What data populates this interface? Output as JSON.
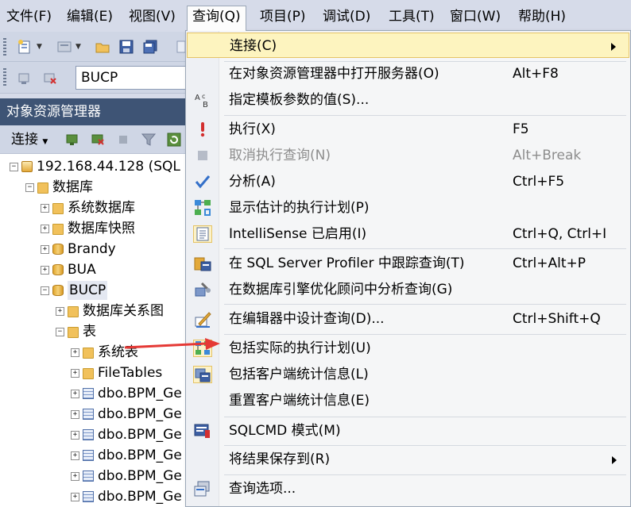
{
  "menubar": {
    "items": [
      "文件(F)",
      "编辑(E)",
      "视图(V)",
      "查询(Q)",
      "项目(P)",
      "调试(D)",
      "工具(T)",
      "窗口(W)",
      "帮助(H)"
    ]
  },
  "toolbar": {
    "database_combo": "BUCP"
  },
  "object_explorer": {
    "title": "对象资源管理器",
    "connect_label": "连接",
    "tree": [
      "192.168.44.128 (SQL",
      "数据库",
      "系统数据库",
      "数据库快照",
      "Brandy",
      "BUA",
      "BUCP",
      "数据库关系图",
      "表",
      "系统表",
      "FileTables",
      "dbo.BPM_Ge",
      "dbo.BPM_Ge",
      "dbo.BPM_Ge",
      "dbo.BPM_Ge",
      "dbo.BPM_Ge",
      "dbo.BPM_Ge"
    ]
  },
  "query_menu": {
    "items": [
      {
        "label": "连接(C)",
        "shortcut": ""
      },
      {
        "label": "在对象资源管理器中打开服务器(O)",
        "shortcut": "Alt+F8"
      },
      {
        "label": "指定模板参数的值(S)...",
        "shortcut": ""
      },
      {
        "label": "执行(X)",
        "shortcut": "F5"
      },
      {
        "label": "取消执行查询(N)",
        "shortcut": "Alt+Break"
      },
      {
        "label": "分析(A)",
        "shortcut": "Ctrl+F5"
      },
      {
        "label": "显示估计的执行计划(P)",
        "shortcut": ""
      },
      {
        "label": "IntelliSense 已启用(I)",
        "shortcut": "Ctrl+Q, Ctrl+I"
      },
      {
        "label": "在 SQL Server Profiler 中跟踪查询(T)",
        "shortcut": "Ctrl+Alt+P"
      },
      {
        "label": "在数据库引擎优化顾问中分析查询(G)",
        "shortcut": ""
      },
      {
        "label": "在编辑器中设计查询(D)...",
        "shortcut": "Ctrl+Shift+Q"
      },
      {
        "label": "包括实际的执行计划(U)",
        "shortcut": ""
      },
      {
        "label": "包括客户端统计信息(L)",
        "shortcut": ""
      },
      {
        "label": "重置客户端统计信息(E)",
        "shortcut": ""
      },
      {
        "label": "SQLCMD 模式(M)",
        "shortcut": ""
      },
      {
        "label": "将结果保存到(R)",
        "shortcut": ""
      },
      {
        "label": "查询选项...",
        "shortcut": ""
      }
    ]
  },
  "colors": {
    "highlight_bg": "#fdf4bf",
    "highlight_border": "#e5c365",
    "annotation_arrow": "#e53935",
    "panel_title": "#3e5475"
  }
}
